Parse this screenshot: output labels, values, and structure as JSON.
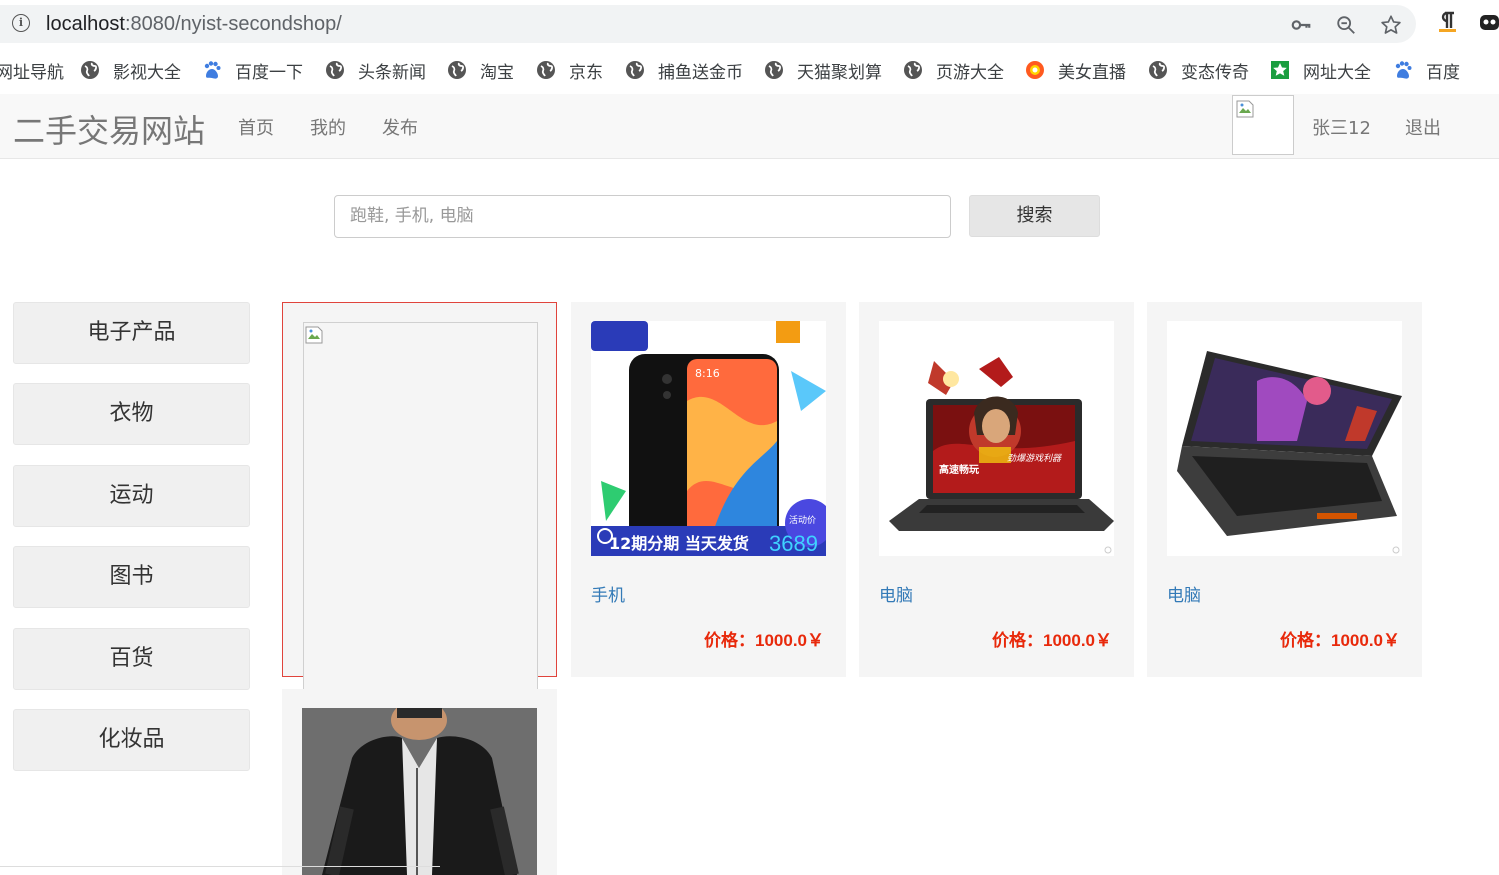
{
  "browser": {
    "url_host": "localhost",
    "url_rest": ":8080/nyist-secondshop/",
    "bookmarks": [
      {
        "label": "网址导航",
        "icon": "globe-icon"
      },
      {
        "label": "影视大全",
        "icon": "globe-icon"
      },
      {
        "label": "百度一下",
        "icon": "baidu-paw-icon"
      },
      {
        "label": "头条新闻",
        "icon": "globe-icon"
      },
      {
        "label": "淘宝",
        "icon": "globe-icon"
      },
      {
        "label": "京东",
        "icon": "globe-icon"
      },
      {
        "label": "捕鱼送金币",
        "icon": "globe-icon"
      },
      {
        "label": "天猫聚划算",
        "icon": "globe-icon"
      },
      {
        "label": "页游大全",
        "icon": "globe-icon"
      },
      {
        "label": "美女直播",
        "icon": "live-icon"
      },
      {
        "label": "变态传奇",
        "icon": "globe-icon"
      },
      {
        "label": "网址大全",
        "icon": "star-grid-icon"
      },
      {
        "label": "百度",
        "icon": "baidu-paw-icon"
      }
    ]
  },
  "header": {
    "brand": "二手交易网站",
    "nav": [
      "首页",
      "我的",
      "发布"
    ],
    "username": "张三12",
    "logout": "退出"
  },
  "search": {
    "placeholder": "跑鞋, 手机, 电脑",
    "button": "搜索"
  },
  "categories": [
    "电子产品",
    "衣物",
    "运动",
    "图书",
    "百货",
    "化妆品"
  ],
  "products": [
    {
      "title": "",
      "price": "",
      "image": "broken-image"
    },
    {
      "title": "手机",
      "price": "价格：1000.0￥",
      "image": "phone-photo",
      "banner_text": "12期分期  当天发货",
      "banner_price": "3689",
      "badge": "活动价",
      "screen_time": "8:16"
    },
    {
      "title": "电脑",
      "price": "价格：1000.0￥",
      "image": "laptop-ironman-photo",
      "screen_texts": [
        "高速畅玩",
        "劲爆游戏利器"
      ]
    },
    {
      "title": "电脑",
      "price": "价格：1000.0￥",
      "image": "laptop-photo"
    },
    {
      "title": "",
      "price": "",
      "image": "jacket-photo"
    }
  ],
  "colors": {
    "price": "#e8290b",
    "link": "#337ab7",
    "header_bg": "#f8f8f8",
    "card_bg": "#f5f5f5",
    "selected_border": "#e0443c"
  }
}
